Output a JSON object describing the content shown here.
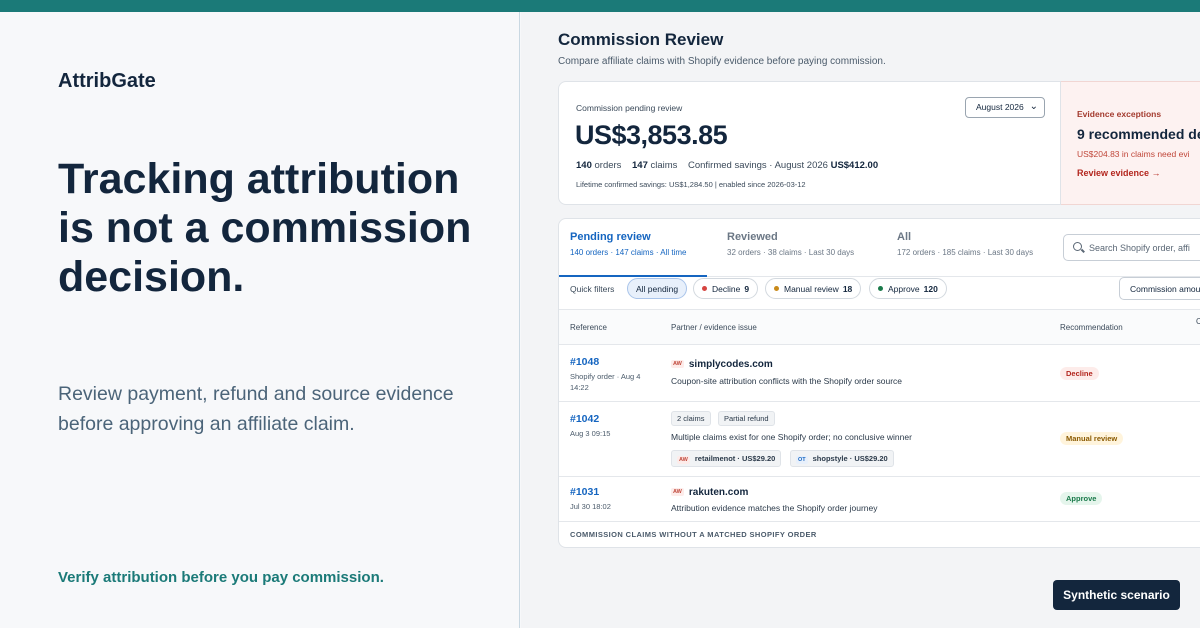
{
  "marketing": {
    "brand": "AttribGate",
    "headline": "Tracking attribution is not a commission decision.",
    "subcopy": "Review payment, refund and source evidence before approving an affiliate claim.",
    "tagline": "Verify attribution before you pay commission."
  },
  "colors": {
    "accent_teal": "#1b7a78",
    "navy": "#13263d",
    "link_blue": "#1565c0",
    "decline_red": "#b3261e",
    "manual_amber": "#8a5a00",
    "approve_green": "#1a7a4a"
  },
  "app": {
    "title": "Commission Review",
    "subtitle": "Compare affiliate claims with Shopify evidence before paying commission.",
    "summary": {
      "label": "Commission pending review",
      "amount": "US$3,853.85",
      "orders_count": "140",
      "orders_label": "orders",
      "claims_count": "147",
      "claims_label": "claims",
      "savings_label": "Confirmed savings · August 2026",
      "savings_value": "US$412.00",
      "lifetime": "Lifetime confirmed savings: US$1,284.50 | enabled since 2026-03-12",
      "month_select": "August 2026",
      "month_icon": "chevron-down-icon"
    },
    "exceptions": {
      "label": "Evidence exceptions",
      "title": "9 recommended de",
      "note": "US$204.83 in claims need evi",
      "link": "Review evidence →"
    },
    "tabs": [
      {
        "name": "Pending review",
        "meta": "140 orders · 147 claims · All time"
      },
      {
        "name": "Reviewed",
        "meta": "32 orders · 38 claims · Last 30 days"
      },
      {
        "name": "All",
        "meta": "172 orders · 185 claims · Last 30 days"
      }
    ],
    "search": {
      "placeholder": "Search Shopify order, affi",
      "icon": "search-icon"
    },
    "quick_filters": {
      "label": "Quick filters",
      "chips": [
        {
          "label": "All pending",
          "count": ""
        },
        {
          "label": "Decline",
          "count": "9",
          "color": "#d64541"
        },
        {
          "label": "Manual review",
          "count": "18",
          "color": "#c98a1a"
        },
        {
          "label": "Approve",
          "count": "120",
          "color": "#1a7a4a"
        }
      ],
      "amount_button": "Commission amou"
    },
    "table": {
      "headers": {
        "reference": "Reference",
        "partner": "Partner / evidence issue",
        "recommendation": "Recommendation",
        "extra": "C"
      },
      "rows": [
        {
          "ref": "#1048",
          "ref_sub": "Shopify order · Aug 4 14:22",
          "partner_badge": "AW",
          "partner": "simplycodes.com",
          "issue": "Coupon-site attribution conflicts with the Shopify order source",
          "recommendation": "Decline"
        },
        {
          "ref": "#1042",
          "ref_sub": "Aug 3 09:15",
          "tag_claims": "2 claims",
          "tag_refund": "Partial refund",
          "issue": "Multiple claims exist for one Shopify order; no conclusive winner",
          "sub_claims": [
            {
              "badge": "AW",
              "text": "retailmenot · US$29.20"
            },
            {
              "badge": "OT",
              "text": "shopstyle · US$29.20"
            }
          ],
          "recommendation": "Manual review"
        },
        {
          "ref": "#1031",
          "ref_sub": "Jul 30 18:02",
          "partner_badge": "AW",
          "partner": "rakuten.com",
          "issue": "Attribution evidence matches the Shopify order journey",
          "recommendation": "Approve"
        }
      ],
      "footnote": "COMMISSION CLAIMS WITHOUT A MATCHED SHOPIFY ORDER"
    }
  },
  "badge": "Synthetic scenario"
}
